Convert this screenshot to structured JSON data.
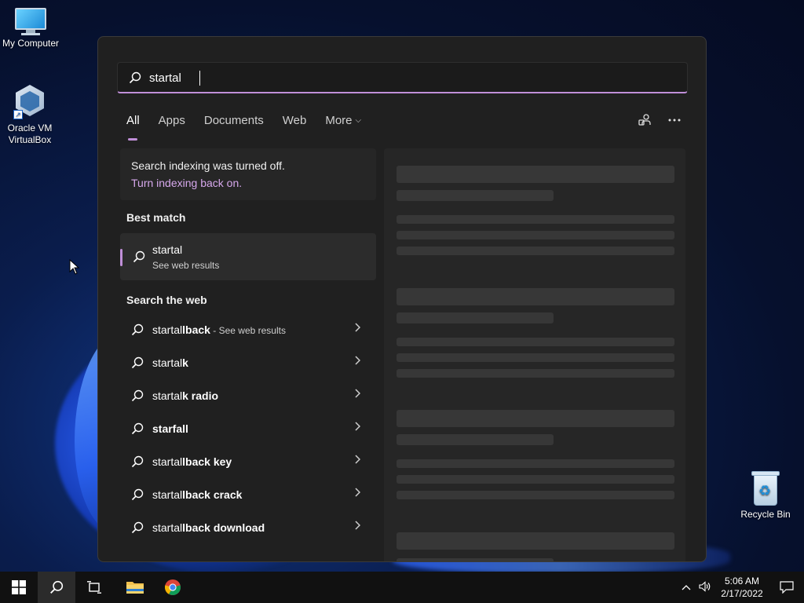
{
  "desktop": {
    "icons": {
      "my_computer": "My Computer",
      "virtualbox": "Oracle VM VirtualBox",
      "recycle_bin": "Recycle Bin"
    }
  },
  "search": {
    "query": "startal",
    "tabs": {
      "all": "All",
      "apps": "Apps",
      "documents": "Documents",
      "web": "Web",
      "more": "More"
    },
    "notice": {
      "message": "Search indexing was turned off.",
      "link": "Turn indexing back on."
    },
    "best_match": {
      "title": "Best match",
      "item_title": "startal",
      "item_subtitle": "See web results"
    },
    "web_section_title": "Search the web",
    "web_results": [
      {
        "prefix": "startal",
        "suffix": "lback",
        "note": " - See web results"
      },
      {
        "prefix": "startal",
        "suffix": "k",
        "note": ""
      },
      {
        "prefix": "startal",
        "suffix": "k radio",
        "note": ""
      },
      {
        "prefix": "",
        "suffix": "starfall",
        "note": ""
      },
      {
        "prefix": "startal",
        "suffix": "lback key",
        "note": ""
      },
      {
        "prefix": "startal",
        "suffix": "lback crack",
        "note": ""
      },
      {
        "prefix": "startal",
        "suffix": "lback download",
        "note": ""
      }
    ]
  },
  "taskbar": {
    "time": "5:06 AM",
    "date": "2/17/2022"
  },
  "colors": {
    "accent": "#c08fd8",
    "panel_bg": "#202020",
    "taskbar_bg": "#111111"
  }
}
